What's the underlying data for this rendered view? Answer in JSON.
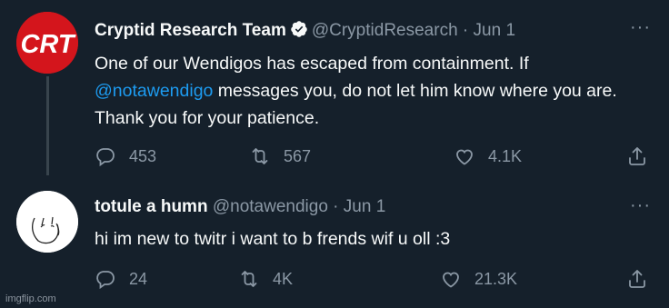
{
  "tweets": [
    {
      "avatar_text": "CRT",
      "name": "Cryptid Research Team",
      "verified": true,
      "handle": "@CryptidResearch",
      "separator": "·",
      "date": "Jun 1",
      "more_icon": "more-horizontal-icon",
      "text_before": "One of our Wendigos has escaped from containment. If",
      "mention": "@notawendigo",
      "text_after": " messages you, do not let him know where you are. Thank you for your patience.",
      "reply_count": "453",
      "retweet_count": "567",
      "like_count": "4.1K"
    },
    {
      "name": "totule a humn",
      "handle": "@notawendigo",
      "separator": "·",
      "date": "Jun 1",
      "more_icon": "more-horizontal-icon",
      "text": "hi im new to twitr i want to b frends wif u oll :3",
      "reply_count": "24",
      "retweet_count": "4K",
      "like_count": "21.3K"
    }
  ],
  "watermark": "imgflip.com",
  "colors": {
    "background": "#15202b",
    "text": "#f7f9f9",
    "muted": "#8b98a5",
    "link": "#1d9bf0",
    "brand_red": "#d4151c"
  }
}
